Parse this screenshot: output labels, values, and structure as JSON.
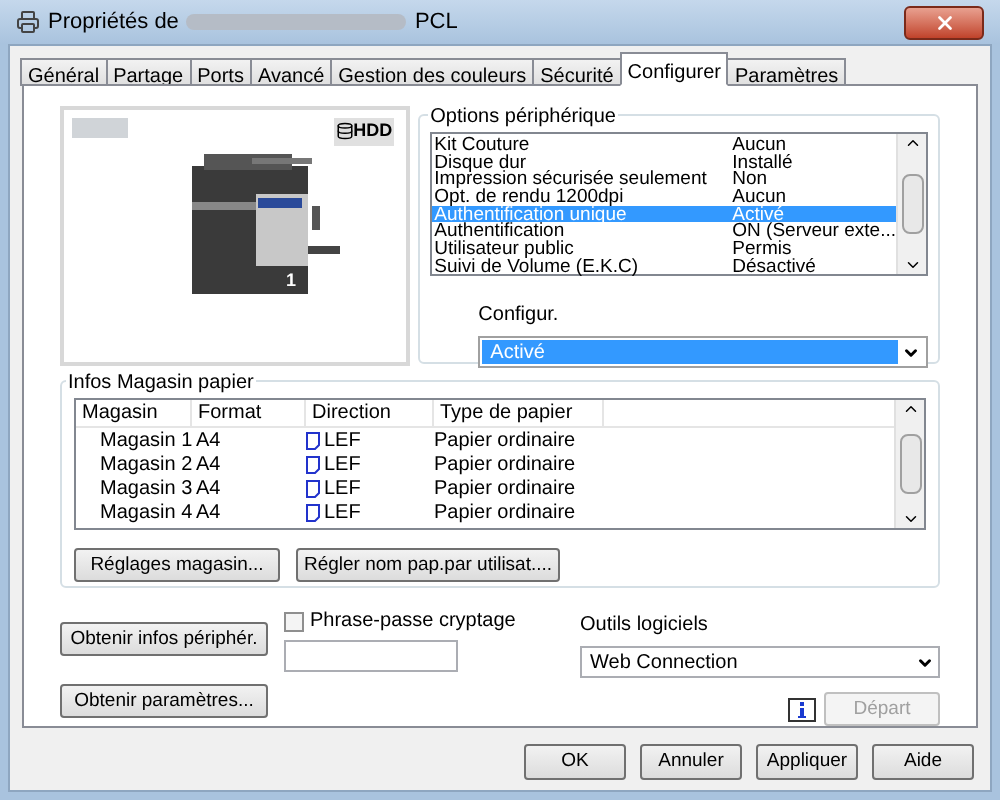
{
  "window": {
    "title_start": "Propriétés de",
    "title_end": "PCL"
  },
  "tabs": [
    {
      "label": "Général",
      "selected": false
    },
    {
      "label": "Partage",
      "selected": false
    },
    {
      "label": "Ports",
      "selected": false
    },
    {
      "label": "Avancé",
      "selected": false
    },
    {
      "label": "Gestion des couleurs",
      "selected": false
    },
    {
      "label": "Sécurité",
      "selected": false
    },
    {
      "label": "Configurer",
      "selected": true
    },
    {
      "label": "Paramètres",
      "selected": false
    }
  ],
  "preview": {
    "badge": "HDD",
    "tray_number": "1"
  },
  "device_options": {
    "title": "Options périphérique",
    "rows": [
      {
        "name": "Kit Couture",
        "value": "Aucun",
        "selected": false
      },
      {
        "name": "Disque dur",
        "value": "Installé",
        "selected": false
      },
      {
        "name": "Impression sécurisée seulement",
        "value": "Non",
        "selected": false
      },
      {
        "name": "Opt. de rendu 1200dpi",
        "value": "Aucun",
        "selected": false
      },
      {
        "name": "Authentification unique",
        "value": "Activé",
        "selected": true
      },
      {
        "name": "Authentification",
        "value": "ON (Serveur exte...",
        "selected": false
      },
      {
        "name": "Utilisateur public",
        "value": "Permis",
        "selected": false
      },
      {
        "name": "Suivi de Volume (E.K.C)",
        "value": "Désactivé",
        "selected": false
      }
    ],
    "setting_label": "Configur.",
    "setting_value": "Activé"
  },
  "paper_trays": {
    "title": "Infos Magasin papier",
    "columns": [
      "Magasin",
      "Format",
      "Direction",
      "Type de papier"
    ],
    "rows": [
      {
        "tray": "Magasin 1",
        "size": "A4",
        "direction": "LEF",
        "type": "Papier ordinaire"
      },
      {
        "tray": "Magasin 2",
        "size": "A4",
        "direction": "LEF",
        "type": "Papier ordinaire"
      },
      {
        "tray": "Magasin 3",
        "size": "A4",
        "direction": "LEF",
        "type": "Papier ordinaire"
      },
      {
        "tray": "Magasin 4",
        "size": "A4",
        "direction": "LEF",
        "type": "Papier ordinaire"
      }
    ],
    "buttons": [
      "Réglages magasin...",
      "Régler nom pap.par utilisat...."
    ]
  },
  "device_info_button": "Obtenir infos périphér.",
  "settings_button": "Obtenir paramètres...",
  "passphrase": {
    "label": "Phrase-passe cryptage",
    "checked": false
  },
  "tools": {
    "label": "Outils logiciels",
    "value": "Web Connection",
    "start_button": "Départ",
    "start_disabled": true
  },
  "buttons": [
    "OK",
    "Annuler",
    "Appliquer",
    "Aide"
  ]
}
